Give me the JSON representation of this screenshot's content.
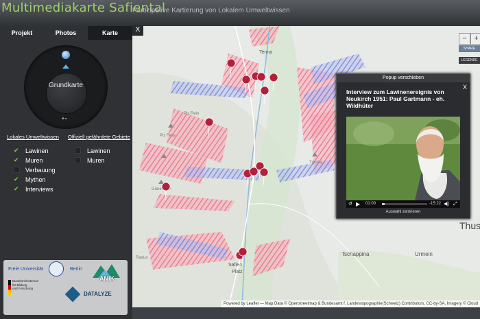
{
  "header": {
    "title": "Multimediakarte Safiental",
    "separator": "-",
    "subtitle": "Partizipative Kartierung von Lokalem Umweltwissen"
  },
  "tabs": [
    {
      "label": "Projekt",
      "active": false
    },
    {
      "label": "Photos",
      "active": false
    },
    {
      "label": "Karte",
      "active": true
    }
  ],
  "panel_close": "X",
  "dial": {
    "label": "Grundkarte"
  },
  "sections": {
    "local": "Lokales Umweltwissen",
    "official": "Offiziell gefährdete Gebiete"
  },
  "local_layers": [
    {
      "label": "Lawinen",
      "checked": true
    },
    {
      "label": "Muren",
      "checked": true
    },
    {
      "label": "Verbauung",
      "checked": false
    },
    {
      "label": "Mythen",
      "checked": true
    },
    {
      "label": "Interviews",
      "checked": true
    }
  ],
  "official_layers": [
    {
      "label": "Lawinen",
      "checked": false
    },
    {
      "label": "Muren",
      "checked": false
    }
  ],
  "logos": {
    "fu": "Freie Universität",
    "berlin": "Berlin",
    "bmbf": [
      "Bundesministerium",
      "für Bildung",
      "und Forschung"
    ],
    "anik": "ANIK",
    "datalyze": "DATALYZE"
  },
  "map": {
    "place_labels": [
      "Tenna",
      "Piz Rein",
      "Piz Fess",
      "Tguma",
      "Günerhorn",
      "Tschappina",
      "Urmein",
      "Thus",
      "Safien",
      "Platz",
      "Radun"
    ],
    "zoom_in": "+",
    "zoom_out": "−",
    "share": "SHARE",
    "legend": "LEGENDE",
    "attribution": "Powered by Leaflet — Map Data © Openstreetmap & Bundesamt f. Landestopographie(Schweiz) Contributors, CC-by-SA, Imagery © Cloud"
  },
  "popup": {
    "top_label": "Popup verschieben",
    "close": "X",
    "title": "Interview zum Lawinenereignis von Neukirch 1951: Paul Gartmann - eh. Wildhüter",
    "time_current": "01:00",
    "time_remaining": "-15:22",
    "footer": "Auswahl zentrieren"
  },
  "colors": {
    "accent": "#9fd26a",
    "avalanche": "#f06b86",
    "debris": "#6f7fe0",
    "marker": "#b3203a"
  }
}
